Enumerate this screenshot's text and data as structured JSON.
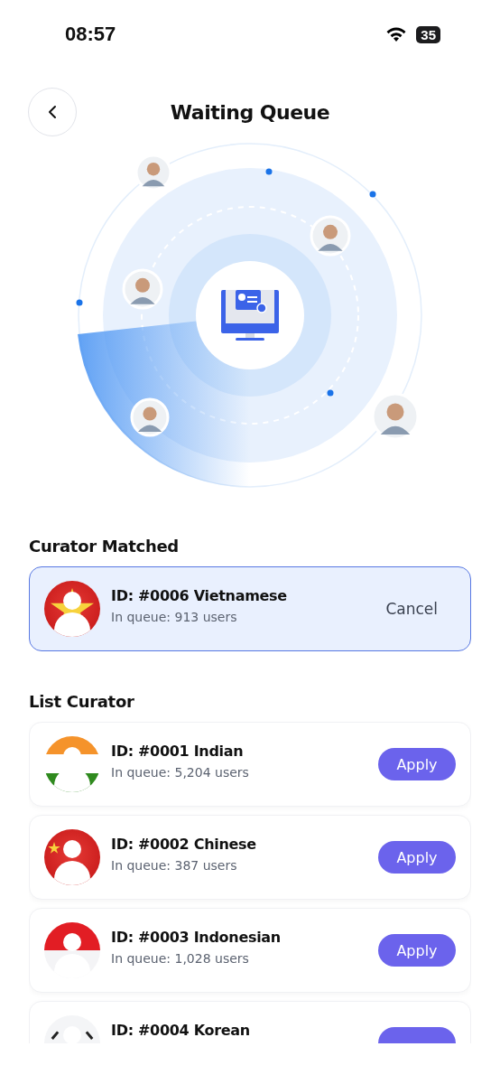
{
  "status_bar": {
    "time": "08:57",
    "battery": "35"
  },
  "header": {
    "title": "Waiting Queue"
  },
  "matched": {
    "heading": "Curator Matched",
    "curator": {
      "title": "ID: #0006 Vietnamese",
      "queue": "In queue: 913 users",
      "kind": "vietnam"
    },
    "action": "Cancel"
  },
  "list": {
    "heading": "List Curator",
    "curators": [
      {
        "title": "ID: #0001 Indian",
        "queue": "In queue: 5,204 users",
        "kind": "india",
        "action": "Apply"
      },
      {
        "title": "ID: #0002 Chinese",
        "queue": "In queue: 387 users",
        "kind": "china",
        "action": "Apply"
      },
      {
        "title": "ID: #0003 Indonesian",
        "queue": "In queue: 1,028 users",
        "kind": "indonesia",
        "action": "Apply"
      },
      {
        "title": "ID: #0004 Korean",
        "kind": "korea"
      }
    ]
  }
}
